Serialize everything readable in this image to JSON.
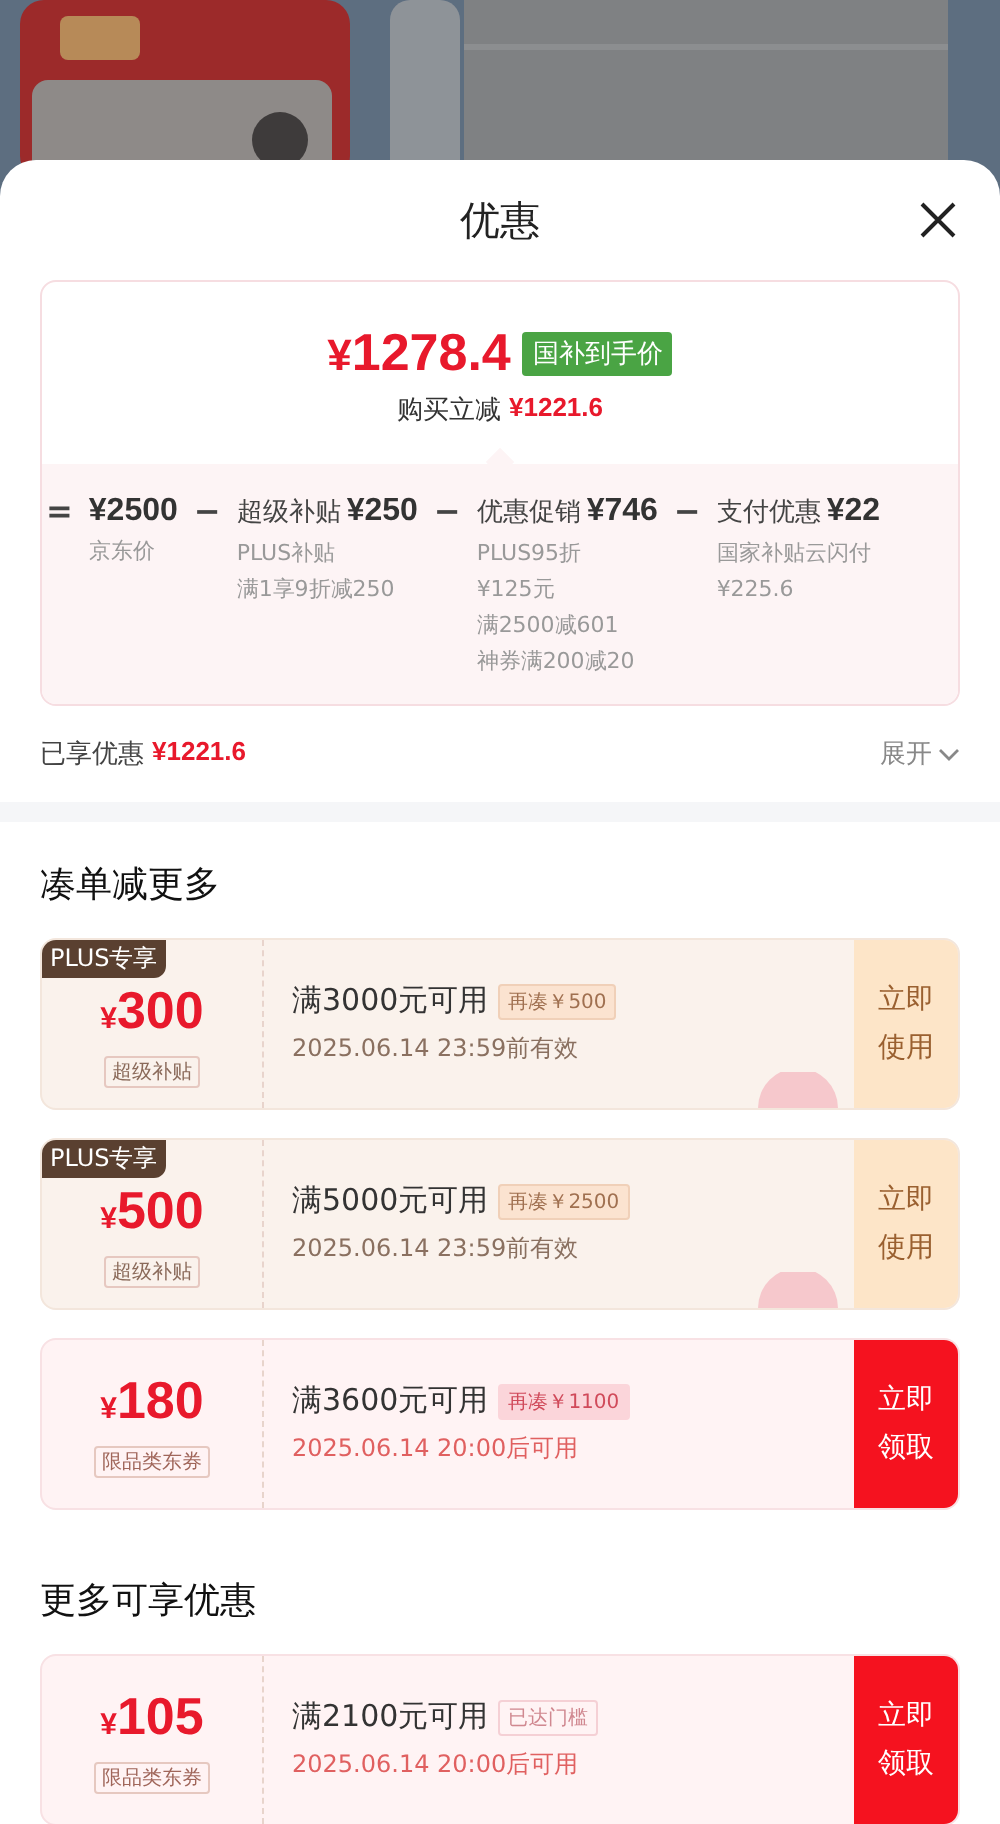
{
  "sheet": {
    "title": "优惠"
  },
  "price_card": {
    "price_symbol": "¥",
    "price": "1278.4",
    "price_badge": "国补到手价",
    "saving_label": "购买立减",
    "saving": "¥1221.6",
    "breakdown": [
      {
        "operator": "=",
        "amount": "¥2500",
        "notes": [
          "京东价"
        ]
      },
      {
        "operator": "−",
        "label": "超级补贴",
        "amount": "¥250",
        "notes": [
          "PLUS补贴",
          "满1享9折减250"
        ]
      },
      {
        "operator": "−",
        "label": "优惠促销",
        "amount": "¥746",
        "notes": [
          "PLUS95折",
          "¥125元",
          "满2500减601",
          "神券满200减20"
        ]
      },
      {
        "operator": "−",
        "label": "支付优惠",
        "amount": "¥22",
        "notes": [
          "国家补贴云闪付",
          "¥225.6"
        ]
      }
    ]
  },
  "summary": {
    "label": "已享优惠",
    "amount": "¥1221.6",
    "toggle": "展开"
  },
  "sections": [
    {
      "title": "凑单减更多",
      "coupons": [
        {
          "kind": "plus",
          "ribbon": "PLUS专享",
          "symbol": "¥",
          "amount": "300",
          "type": "超级补贴",
          "condition": "满3000元可用",
          "tag": "再凑￥500",
          "tag_filled": true,
          "validity": "2025.06.14 23:59前有效",
          "stamp": true,
          "action": "立即使用"
        },
        {
          "kind": "plus",
          "ribbon": "PLUS专享",
          "symbol": "¥",
          "amount": "500",
          "type": "超级补贴",
          "condition": "满5000元可用",
          "tag": "再凑￥2500",
          "tag_filled": true,
          "validity": "2025.06.14 23:59前有效",
          "stamp": true,
          "action": "立即使用"
        },
        {
          "kind": "normal",
          "symbol": "¥",
          "amount": "180",
          "type": "限品类东券",
          "condition": "满3600元可用",
          "tag": "再凑￥1100",
          "tag_filled": true,
          "validity": "2025.06.14 20:00后可用",
          "stamp": false,
          "action": "立即领取"
        }
      ]
    },
    {
      "title": "更多可享优惠",
      "coupons": [
        {
          "kind": "normal",
          "symbol": "¥",
          "amount": "105",
          "type": "限品类东券",
          "condition": "满2100元可用",
          "tag": "已达门槛",
          "tag_filled": false,
          "validity": "2025.06.14 20:00后可用",
          "stamp": false,
          "action": "立即领取"
        }
      ]
    }
  ]
}
